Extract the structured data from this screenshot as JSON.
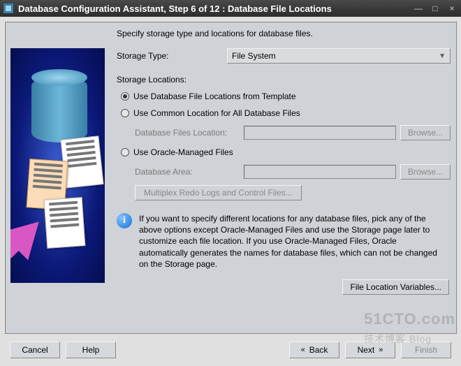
{
  "window": {
    "title": "Database Configuration Assistant, Step 6 of 12 : Database File Locations"
  },
  "instruction": "Specify storage type and locations for database files.",
  "storage_type": {
    "label": "Storage Type:",
    "value": "File System"
  },
  "storage_locations_label": "Storage Locations:",
  "radios": {
    "template": "Use Database File Locations from Template",
    "common": "Use Common Location for All Database Files",
    "omf": "Use Oracle-Managed Files"
  },
  "selected_radio": "template",
  "common_block": {
    "label": "Database Files Location:",
    "value": "",
    "browse": "Browse..."
  },
  "omf_block": {
    "label": "Database Area:",
    "value": "",
    "browse": "Browse...",
    "multiplex": "Multiplex Redo Logs and Control Files..."
  },
  "info_text": "If you want to specify different locations for any database files, pick any of the above options except Oracle-Managed Files and use the Storage page later to customize each file location. If you use Oracle-Managed Files, Oracle automatically generates the names for database files, which can not be changed on the Storage page.",
  "file_loc_button": "File Location Variables...",
  "footer": {
    "cancel": "Cancel",
    "help": "Help",
    "back": "Back",
    "next": "Next",
    "finish": "Finish"
  },
  "watermark": {
    "main": "51CTO.com",
    "sub": "技术博客 Blog"
  }
}
